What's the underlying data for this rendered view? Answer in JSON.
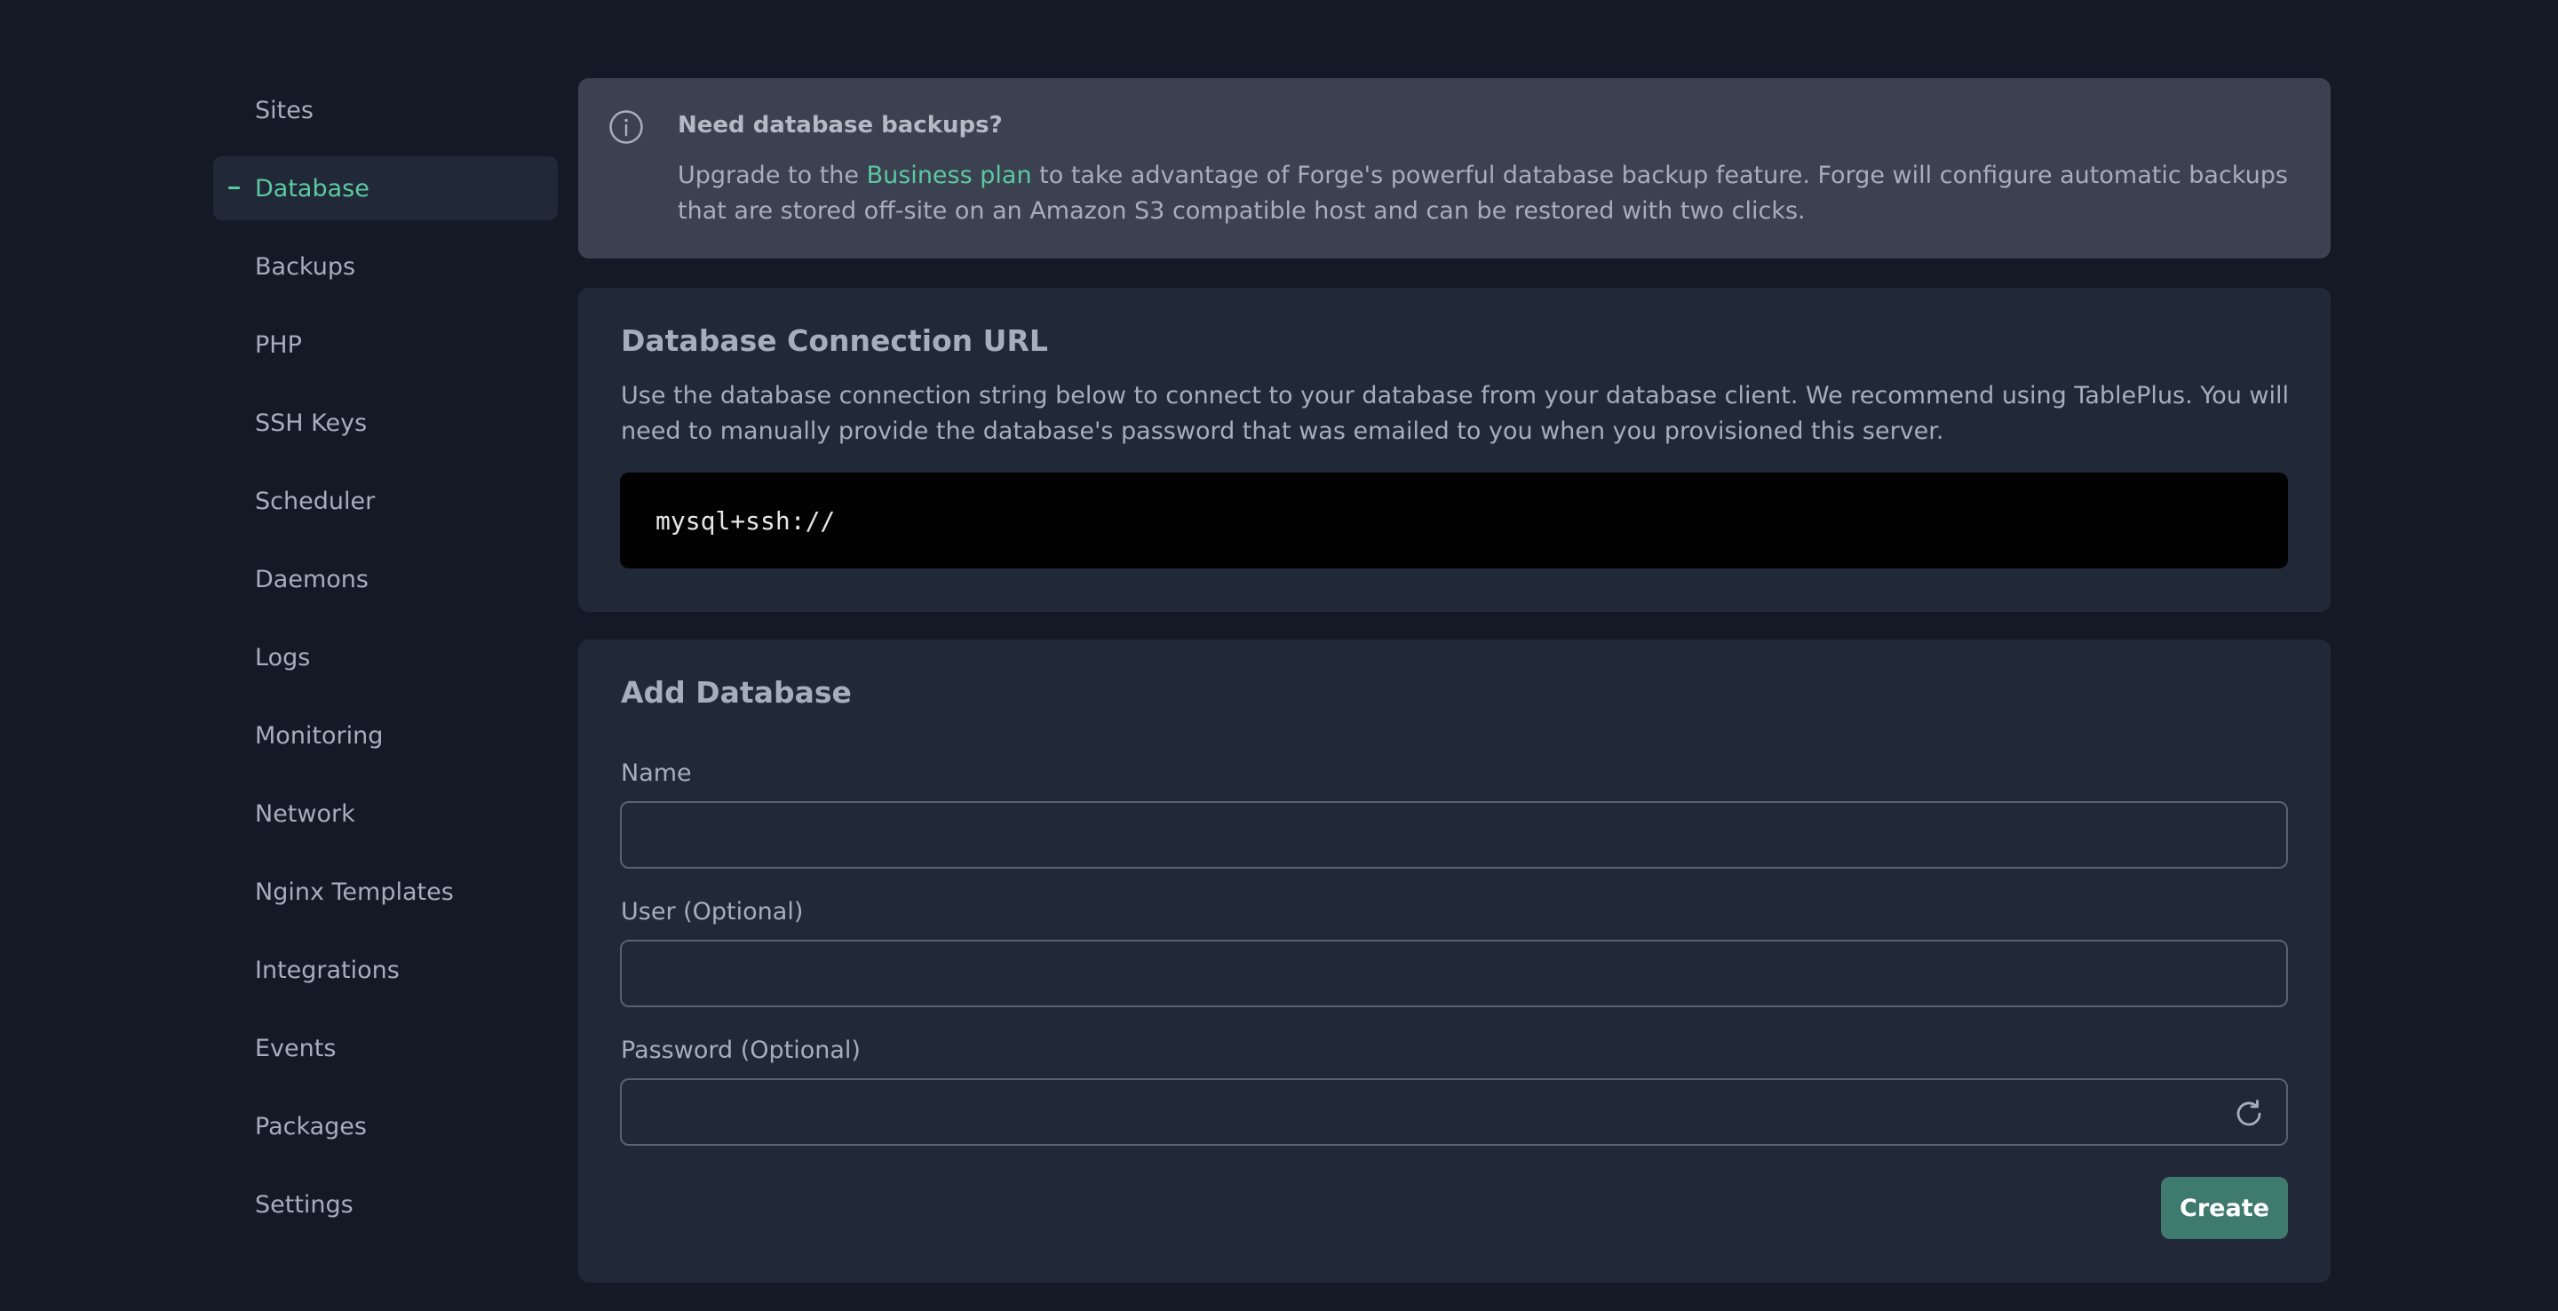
{
  "sidebar": {
    "items": [
      {
        "label": "Sites"
      },
      {
        "label": "Database"
      },
      {
        "label": "Backups"
      },
      {
        "label": "PHP"
      },
      {
        "label": "SSH Keys"
      },
      {
        "label": "Scheduler"
      },
      {
        "label": "Daemons"
      },
      {
        "label": "Logs"
      },
      {
        "label": "Monitoring"
      },
      {
        "label": "Network"
      },
      {
        "label": "Nginx Templates"
      },
      {
        "label": "Integrations"
      },
      {
        "label": "Events"
      },
      {
        "label": "Packages"
      },
      {
        "label": "Settings"
      }
    ],
    "active": "Database"
  },
  "notice": {
    "icon": "info-icon",
    "title": "Need database backups?",
    "text_before": "Upgrade to the ",
    "link_text": "Business plan",
    "text_after": " to take advantage of Forge's powerful database backup feature. Forge will configure automatic backups that are stored off-site on an Amazon S3 compatible host and can be restored with two clicks."
  },
  "connection": {
    "title": "Database Connection URL",
    "description": "Use the database connection string below to connect to your database from your database client. We recommend using TablePlus. You will need to manually provide the database's password that was emailed to you when you provisioned this server.",
    "url": "mysql+ssh://"
  },
  "add_database": {
    "title": "Add Database",
    "name_label": "Name",
    "name_value": "",
    "user_label": "User (Optional)",
    "user_value": "",
    "password_label": "Password (Optional)",
    "password_value": "",
    "refresh_icon": "refresh-icon",
    "create_label": "Create"
  },
  "colors": {
    "background": "#131a26",
    "panel": "#212938",
    "notice": "#3b4150",
    "accent": "#5cc8a0",
    "button": "#3f7a6e"
  }
}
